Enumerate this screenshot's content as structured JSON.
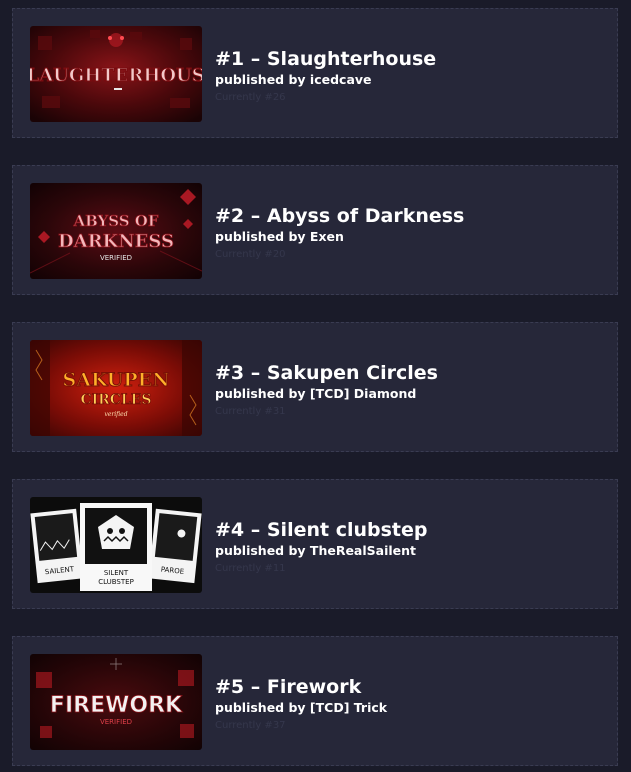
{
  "levels": [
    {
      "title": "#1 – Slaughterhouse",
      "publisher": "published by icedcave",
      "rank_note": "Currently #26",
      "thumbnail_text": "SLAUGHTERHOUSE",
      "theme_colors": [
        "#2a0507",
        "#8a0f12",
        "#e0303a"
      ]
    },
    {
      "title": "#2 – Abyss of Darkness",
      "publisher": "published by Exen",
      "rank_note": "Currently #20",
      "thumbnail_text": "ABYSS OF DARKNESS",
      "thumbnail_subtext": "VERIFIED",
      "theme_colors": [
        "#1c0508",
        "#6e0d16",
        "#d8343e"
      ]
    },
    {
      "title": "#3 – Sakupen Circles",
      "publisher": "published by [TCD] Diamond",
      "rank_note": "Currently #31",
      "thumbnail_text": "SAKUPEN CIRCLES",
      "thumbnail_subtext": "verified",
      "theme_colors": [
        "#3a0603",
        "#b0160c",
        "#ff7a1a"
      ]
    },
    {
      "title": "#4 – Silent clubstep",
      "publisher": "published by TheRealSailent",
      "rank_note": "Currently #11",
      "thumbnail_text": "SILENT CLUBSTEP",
      "thumbnail_subtext_left": "SAILENT",
      "thumbnail_subtext_right": "PAROE",
      "theme_colors": [
        "#0b0b0b",
        "#ffffff",
        "#1e1e1e"
      ]
    },
    {
      "title": "#5 – Firework",
      "publisher": "published by [TCD] Trick",
      "rank_note": "Currently #37",
      "thumbnail_text": "FIREWORK",
      "thumbnail_subtext": "VERIFIED",
      "theme_colors": [
        "#120506",
        "#5a0d10",
        "#e03a40"
      ]
    }
  ]
}
